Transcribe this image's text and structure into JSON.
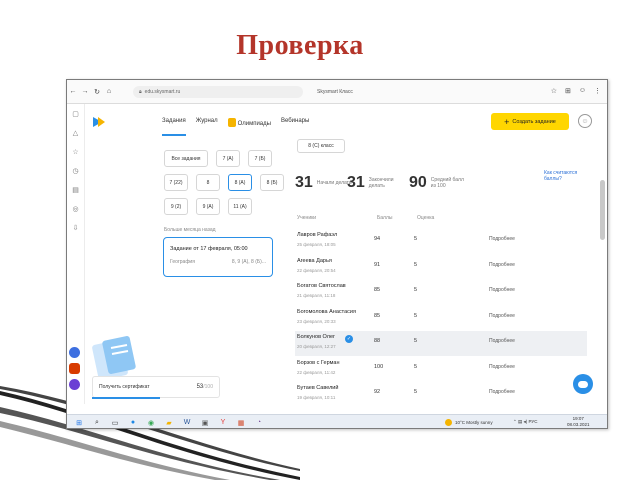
{
  "slide_title": "Проверка",
  "browser": {
    "url": "edu.skysmart.ru",
    "page_title": "Skysmart Класс",
    "icons": [
      "back-arrow-icon",
      "forward-arrow-icon",
      "reload-icon",
      "home-icon"
    ]
  },
  "header": {
    "tabs": [
      {
        "label": "Задания",
        "active": true
      },
      {
        "label": "Журнал",
        "active": false
      },
      {
        "label": "Олимпиады",
        "active": false
      },
      {
        "label": "Вебинары",
        "active": false
      }
    ],
    "create_button": "Создать задание",
    "create_plus": "+"
  },
  "classes": {
    "row1": [
      "Все задания",
      "7 (А)",
      "7 (Б)"
    ],
    "row2": [
      "7 (22)",
      "8",
      "8 (А)",
      "8 (Б)"
    ],
    "row3": [
      "9 (2)",
      "9 (А)",
      "11 (А)"
    ],
    "selected": "8 (А)"
  },
  "older_label": "Больше месяца назад",
  "task_card": {
    "title": "Задание от 17 февраля, 05:00",
    "subject": "География",
    "classes": "8, 9 (А), 8 (Б)..."
  },
  "certificate": {
    "label": "Получить сертификат",
    "points": "53",
    "total": "/100",
    "progress": 0.53
  },
  "class_label": "8 (С) класс",
  "stats": [
    {
      "num": "31",
      "label": "Начали делать"
    },
    {
      "num": "31",
      "label": "Закончили делать"
    },
    {
      "num": "90",
      "label": "Средний балл из 100"
    }
  ],
  "how_calc": "Как считаются баллы?",
  "table": {
    "headers": [
      "Ученики",
      "Баллы",
      "Оценка"
    ],
    "rows": [
      {
        "name": "Лавров Рафаэл",
        "date": "25 февраля, 18:05",
        "score": "94",
        "grade": "5",
        "more": "Подробнее",
        "highlight": false,
        "check": false
      },
      {
        "name": "Агеева Дарья",
        "date": "22 февраля, 20:54",
        "score": "91",
        "grade": "5",
        "more": "Подробнее",
        "highlight": false,
        "check": false
      },
      {
        "name": "Богатов Святослав",
        "date": "21 февраля, 11:18",
        "score": "85",
        "grade": "5",
        "more": "Подробнее",
        "highlight": false,
        "check": false
      },
      {
        "name": "Богомолова Анастасия",
        "date": "23 февраля, 20:33",
        "score": "85",
        "grade": "5",
        "more": "Подробнее",
        "highlight": false,
        "check": false
      },
      {
        "name": "Болкунов Олег",
        "date": "20 февраля, 12:27",
        "score": "88",
        "grade": "5",
        "more": "Подробнее",
        "highlight": true,
        "check": true
      },
      {
        "name": "Борзов с Герман",
        "date": "22 февраля, 11:42",
        "score": "100",
        "grade": "5",
        "more": "Подробнее",
        "highlight": false,
        "check": false
      },
      {
        "name": "Бутаев Савелий",
        "date": "19 февраля, 10:11",
        "score": "92",
        "grade": "5",
        "more": "Подробнее",
        "highlight": false,
        "check": false
      }
    ]
  },
  "taskbar": {
    "weather": "10°C Mostly sunny",
    "lang": "РУС",
    "time": "19:07",
    "date": "08.03.2021"
  },
  "colors": {
    "accent": "#2a8fe6",
    "title": "#b4352a",
    "button": "#ffd600"
  }
}
